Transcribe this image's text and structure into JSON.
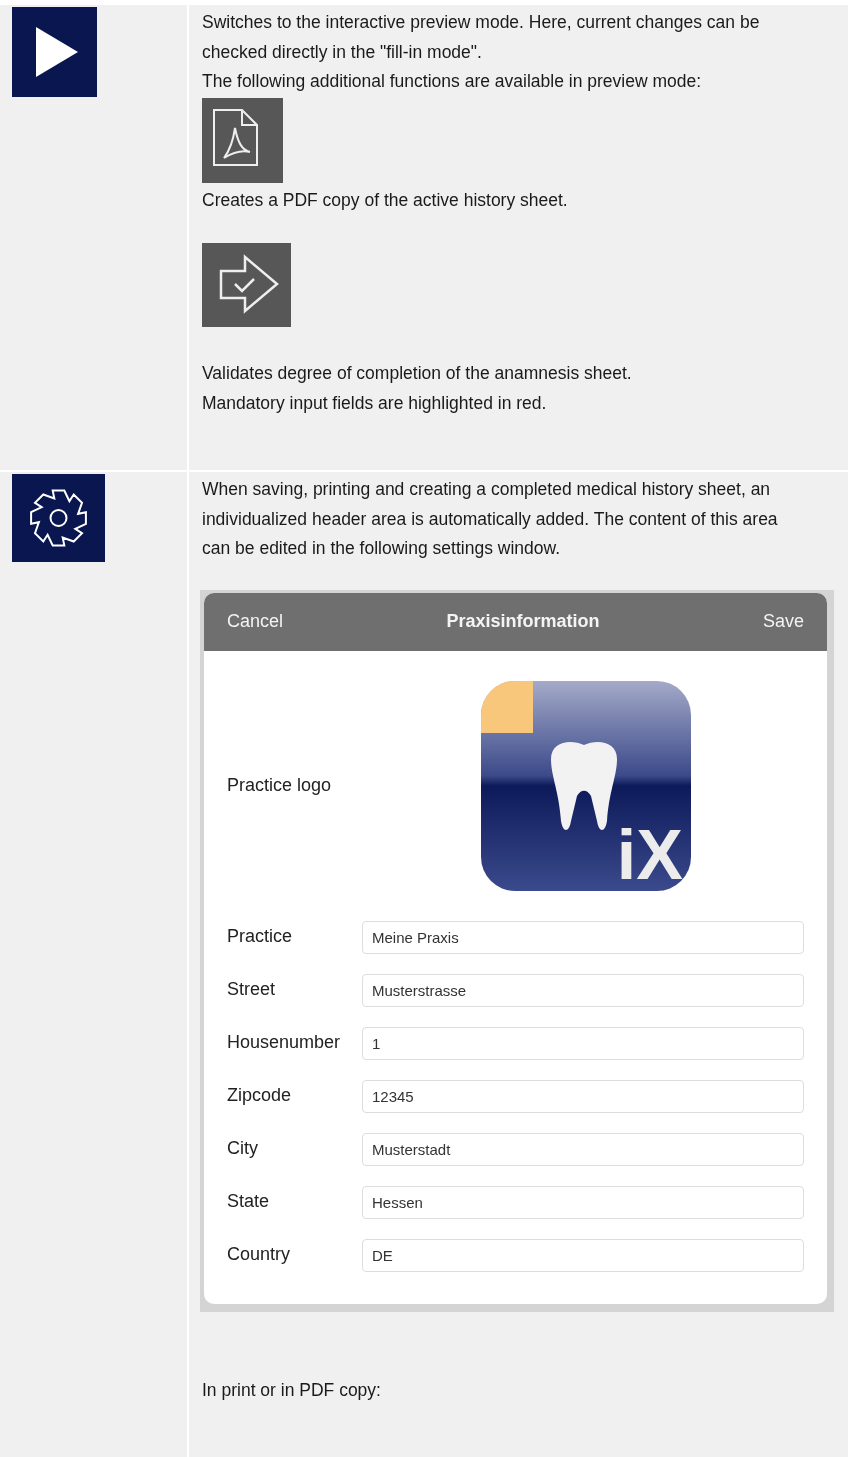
{
  "sections": [
    {
      "kind": "preview",
      "content": [
        {
          "kind": "text",
          "text": "Switches to the interactive preview mode. Here, current changes can be checked directly in the \"fill-in mode\"."
        },
        {
          "kind": "text",
          "text": "The following additional functions are available in preview mode:"
        },
        {
          "kind": "pdf"
        },
        {
          "kind": "text",
          "text": "Creates a PDF copy of the active history sheet."
        },
        {
          "kind": "validate"
        },
        {
          "kind": "text",
          "text": "Validates degree of completion of the anamnesis sheet."
        },
        {
          "kind": "text",
          "text": "Mandatory input fields are highlighted in red."
        }
      ]
    },
    {
      "kind": "settings",
      "content": [
        {
          "kind": "text",
          "text": "When saving, printing and creating a completed medical history sheet, an individualized header area is automatically added. The content of this area can be edited in the following settings window."
        },
        {
          "kind": "dialog",
          "cancel": "Cancel",
          "title": "Praxisinformation",
          "save": "Save",
          "logo_label": "Practice logo",
          "logo_text": "iX",
          "fields": [
            {
              "label": "Practice",
              "value": "Meine Praxis"
            },
            {
              "label": "Street",
              "value": "Musterstrasse"
            },
            {
              "label": "Housenumber",
              "value": "1"
            },
            {
              "label": "Zipcode",
              "value": "12345"
            },
            {
              "label": "City",
              "value": "Musterstadt"
            },
            {
              "label": "State",
              "value": "Hessen"
            },
            {
              "label": "Country",
              "value": "DE"
            }
          ]
        },
        {
          "kind": "text",
          "text": "In print or in PDF copy:"
        }
      ]
    }
  ]
}
